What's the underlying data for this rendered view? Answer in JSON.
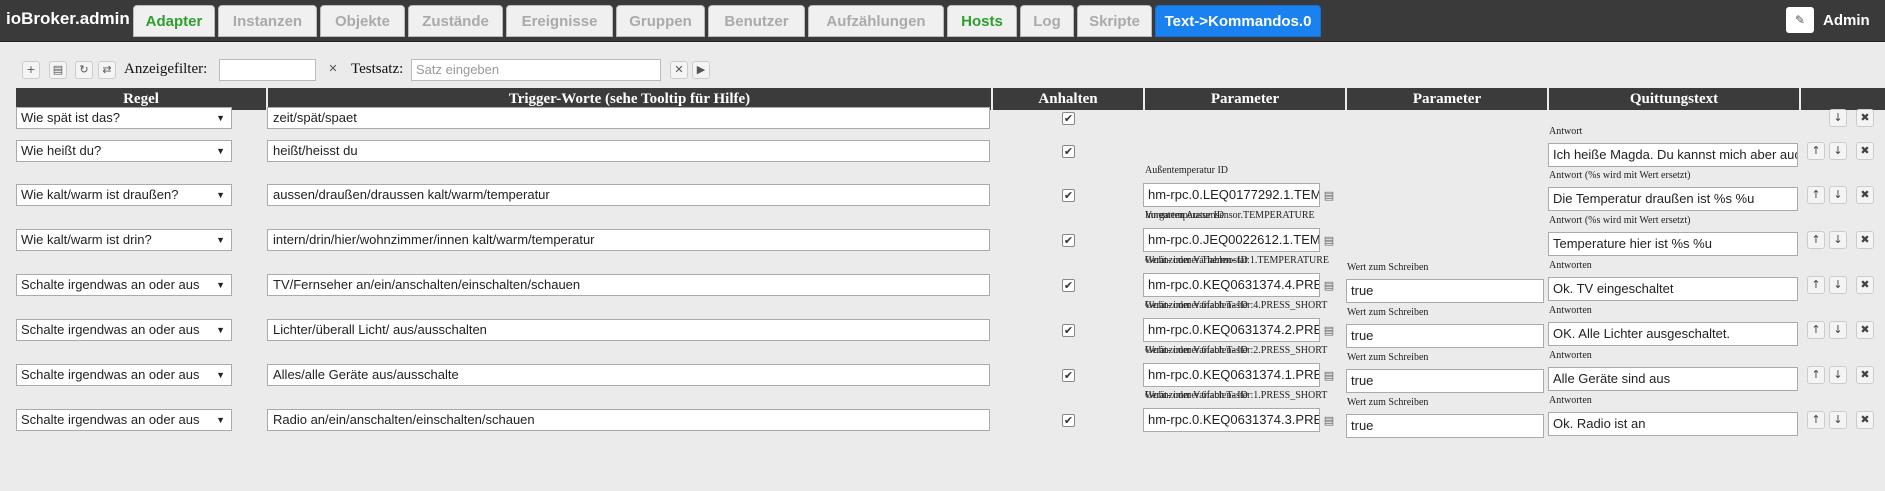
{
  "app": {
    "title": "ioBroker.admin",
    "user": "Admin"
  },
  "tabs": [
    {
      "label": "Adapter",
      "style": "green"
    },
    {
      "label": "Instanzen",
      "style": "gray"
    },
    {
      "label": "Objekte",
      "style": "gray"
    },
    {
      "label": "Zustände",
      "style": "gray"
    },
    {
      "label": "Ereignisse",
      "style": "gray"
    },
    {
      "label": "Gruppen",
      "style": "gray"
    },
    {
      "label": "Benutzer",
      "style": "gray"
    },
    {
      "label": "Aufzählungen",
      "style": "gray"
    },
    {
      "label": "Hosts",
      "style": "green"
    },
    {
      "label": "Log",
      "style": "gray"
    },
    {
      "label": "Skripte",
      "style": "gray"
    },
    {
      "label": "Text->Kommandos.0",
      "style": "active"
    }
  ],
  "toolbar": {
    "filter_label": "Anzeigefilter:",
    "filter_value": "",
    "test_label": "Testsatz:",
    "test_placeholder": "Satz eingeben",
    "icons": [
      "plus-icon",
      "save-icon",
      "refresh-icon",
      "swap-icon"
    ]
  },
  "headers": {
    "rule": "Regel",
    "trigger": "Trigger-Worte (sehe Tooltip für Hilfe)",
    "stop": "Anhalten",
    "param1": "Parameter",
    "param2": "Parameter",
    "ack": "Quittungstext"
  },
  "rows": [
    {
      "rule": "Wie spät ist das?",
      "trigger": "zeit/spät/spaet",
      "stop": true,
      "p1_label": "",
      "p1_value": "",
      "p1_sub": "",
      "p2_label": "",
      "p2_value": "",
      "ack_label": "",
      "ack_value": ""
    },
    {
      "rule": "Wie heißt du?",
      "trigger": "heißt/heisst du",
      "stop": true,
      "p1_label": "",
      "p1_value": "",
      "p1_sub": "",
      "p2_label": "",
      "p2_value": "",
      "ack_label": "Antwort",
      "ack_value": "Ich heiße Magda. Du kannst mich aber auc"
    },
    {
      "rule": "Wie kalt/warm ist draußen?",
      "trigger": "aussen/draußen/draussen kalt/warm/temperatur",
      "stop": true,
      "p1_label": "Außentemperatur ID",
      "p1_value": "hm-rpc.0.LEQ0177292.1.TEMPERATURE",
      "p1_sub": "Vorgarten Aussensensor.TEMPERATURE",
      "p2_label": "",
      "p2_value": "",
      "ack_label": "Antwort (%s wird mit Wert ersetzt)",
      "ack_value": "Die Temperatur draußen ist %s %u"
    },
    {
      "rule": "Wie kalt/warm ist drin?",
      "trigger": "intern/drin/hier/wohnzimmer/innen kalt/warm/temperatur",
      "stop": true,
      "p1_label": "Innentemperatur ID",
      "p1_value": "hm-rpc.0.JEQ0022612.1.TEMPERATURE",
      "p1_sub": "Wohnzimmer Thermostat:1.TEMPERATURE",
      "p2_label": "",
      "p2_value": "",
      "ack_label": "Antwort (%s wird mit Wert ersetzt)",
      "ack_value": "Temperature hier ist %s %u"
    },
    {
      "rule": "Schalte irgendwas an oder aus",
      "trigger": "TV/Fernseher an/ein/anschalten/einschalten/schauen",
      "stop": true,
      "p1_label": "Gerät- oder Variablen- ID",
      "p1_value": "hm-rpc.0.KEQ0631374.4.PRESS_SHORT",
      "p1_sub": "Wohnzimmer 6fach Taster:4.PRESS_SHORT",
      "p2_label": "Wert zum Schreiben",
      "p2_value": "true",
      "ack_label": "Antworten",
      "ack_value": "Ok. TV eingeschaltet"
    },
    {
      "rule": "Schalte irgendwas an oder aus",
      "trigger": "Lichter/überall Licht/ aus/ausschalten",
      "stop": true,
      "p1_label": "Gerät- oder Variablen- ID",
      "p1_value": "hm-rpc.0.KEQ0631374.2.PRESS_SHORT",
      "p1_sub": "Wohnzimmer 6fach Taster:2.PRESS_SHORT",
      "p2_label": "Wert zum Schreiben",
      "p2_value": "true",
      "ack_label": "Antworten",
      "ack_value": "OK. Alle Lichter ausgeschaltet."
    },
    {
      "rule": "Schalte irgendwas an oder aus",
      "trigger": "Alles/alle Geräte aus/ausschalte",
      "stop": true,
      "p1_label": "Gerät- oder Variablen- ID",
      "p1_value": "hm-rpc.0.KEQ0631374.1.PRESS_SHORT",
      "p1_sub": "Wohnzimmer 6fach Taster:1.PRESS_SHORT",
      "p2_label": "Wert zum Schreiben",
      "p2_value": "true",
      "ack_label": "Antworten",
      "ack_value": "Alle Geräte sind aus"
    },
    {
      "rule": "Schalte irgendwas an oder aus",
      "trigger": "Radio an/ein/anschalten/einschalten/schauen",
      "stop": true,
      "p1_label": "Gerät- oder Variablen- ID",
      "p1_value": "hm-rpc.0.KEQ0631374.3.PRESS_SHORT",
      "p1_sub": "",
      "p2_label": "Wert zum Schreiben",
      "p2_value": "true",
      "ack_label": "Antworten",
      "ack_value": "Ok. Radio ist an"
    }
  ]
}
